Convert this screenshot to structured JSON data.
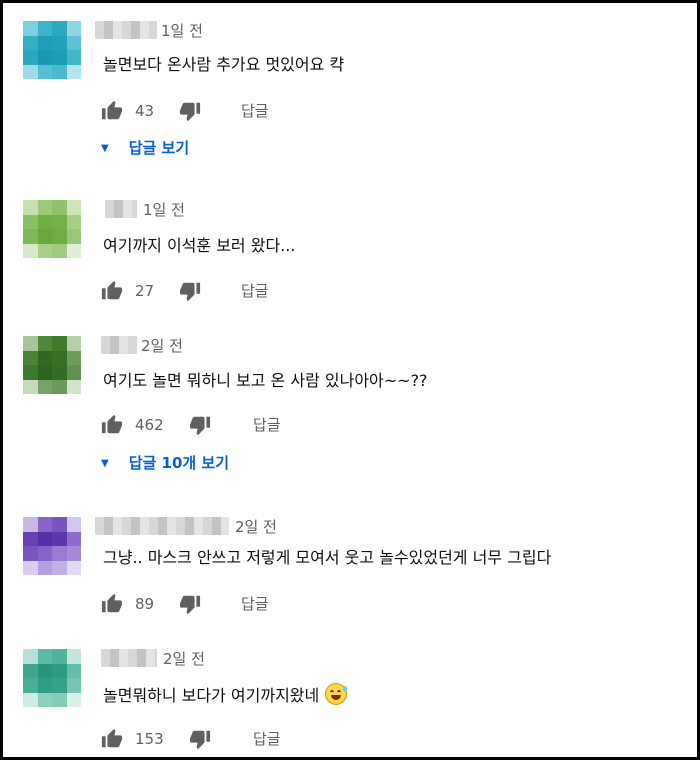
{
  "labels": {
    "reply": "답글"
  },
  "icons": {
    "like": "thumbs-up-icon",
    "dislike": "thumbs-down-icon",
    "expand": "chevron-down-icon",
    "emoji": "grinning-sweat-emoji-icon"
  },
  "colors": {
    "link": "#065fd4",
    "meta": "#606060",
    "text": "#0f0f0f"
  },
  "comments": [
    {
      "author": "",
      "date": "1일 전",
      "text": "놀면보다 온사람 추가요 멋있어요 캭",
      "likes": "43",
      "view_replies": "답글 보기"
    },
    {
      "author": "",
      "date": "1일 전",
      "text": "여기까지 이석훈 보러 왔다...",
      "likes": "27"
    },
    {
      "author": "",
      "date": "2일 전",
      "text": "여기도 놀면 뭐하니 보고 온 사람 있나아아~~??",
      "likes": "462",
      "view_replies": "답글 10개 보기"
    },
    {
      "author": "",
      "date": "2일 전",
      "text": "그냥.. 마스크 안쓰고 저렇게 모여서 웃고 놀수있었던게 너무 그립다",
      "likes": "89"
    },
    {
      "author": "",
      "date": "2일 전",
      "text": "놀면뭐하니 보다가 여기까지왔네",
      "likes": "153"
    }
  ]
}
